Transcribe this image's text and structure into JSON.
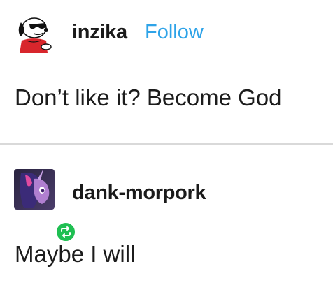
{
  "posts": [
    {
      "username": "inzika",
      "follow_label": "Follow",
      "text": "Don’t like it? Become God",
      "avatar_icon": "snoopy-avatar-icon"
    },
    {
      "username": "dank-morpork",
      "text": "Maybe I will",
      "avatar_icon": "pony-avatar-icon",
      "badge_icon": "reblog-icon"
    }
  ],
  "colors": {
    "follow": "#2ea3e8",
    "reblog_badge": "#1fbf52",
    "divider": "#d9d9d9"
  }
}
